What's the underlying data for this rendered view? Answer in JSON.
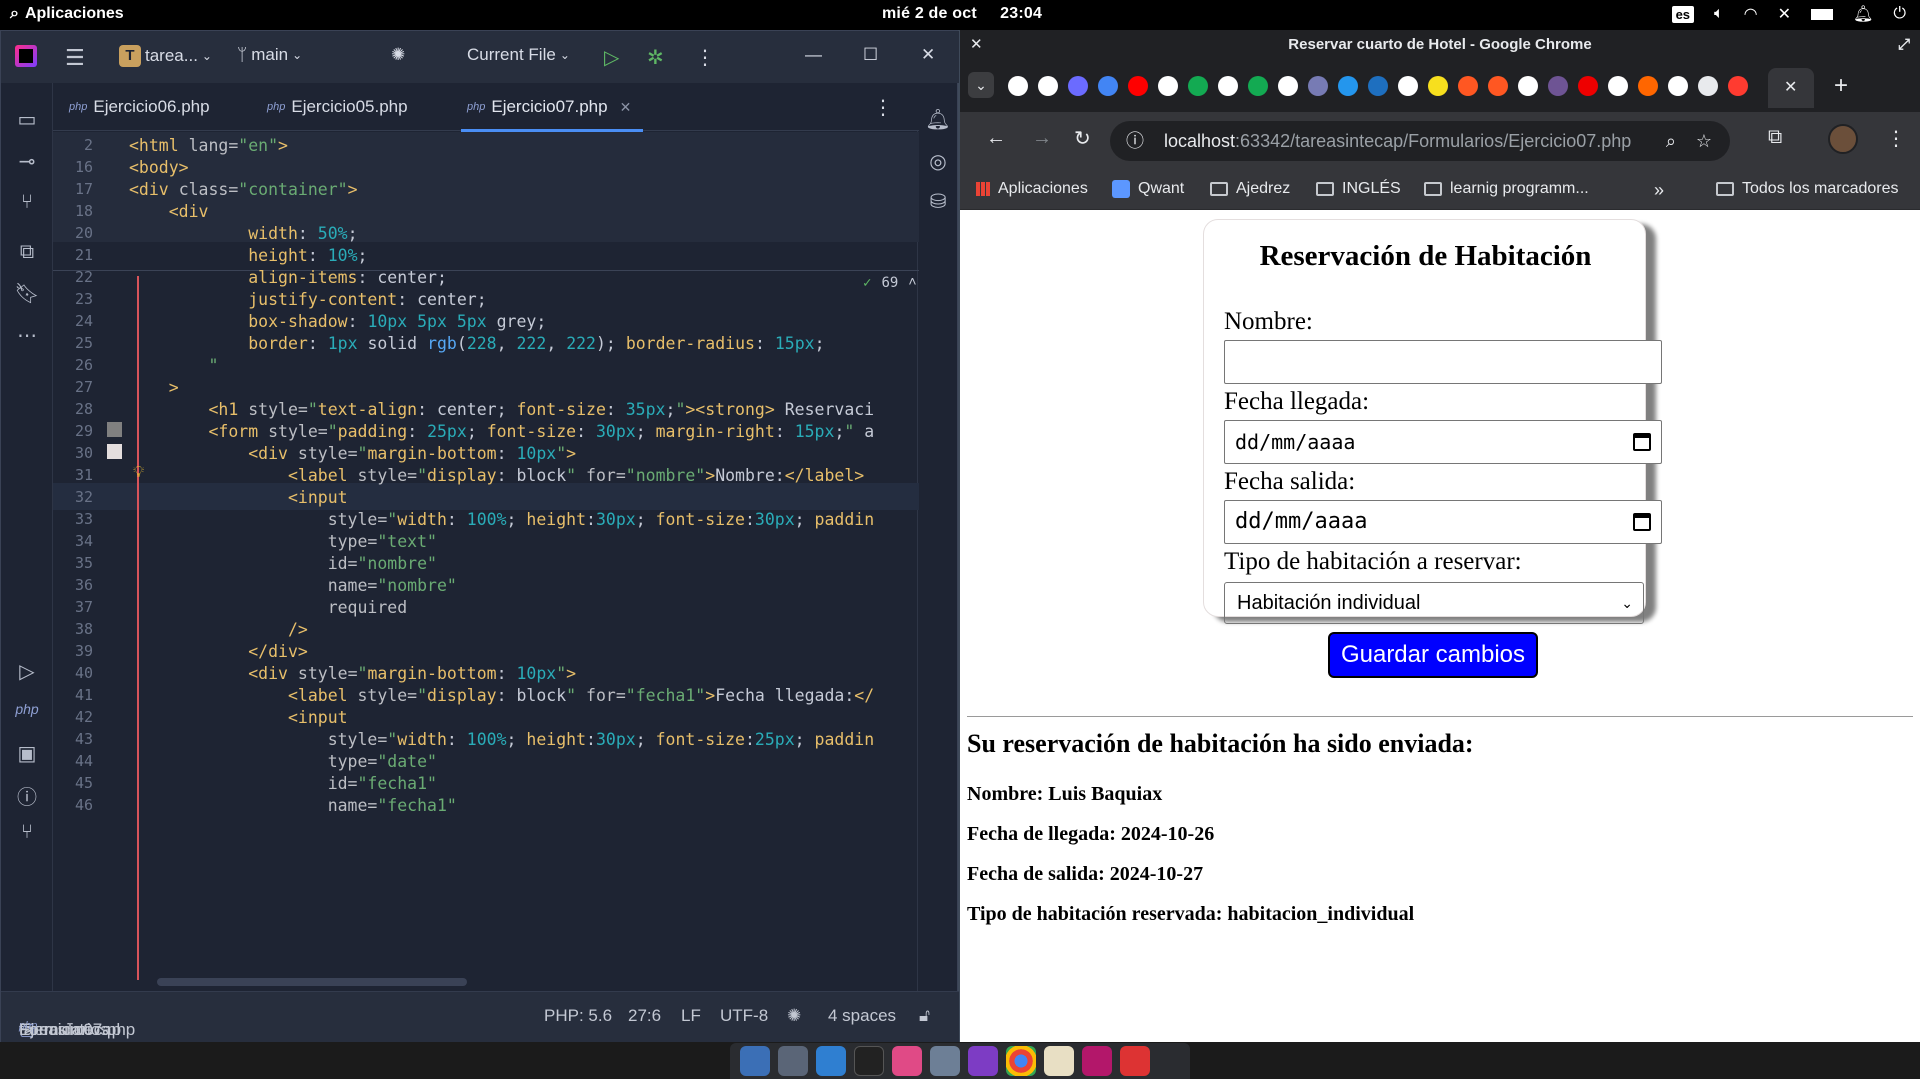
{
  "topbar": {
    "apps_label": "Aplicaciones",
    "datetime": "mié 2 de oct",
    "time": "23:04",
    "keyboard": "es"
  },
  "ide": {
    "project": "tarea...",
    "project_initial": "T",
    "branch": "main",
    "run_config": "Current File",
    "tabs": [
      {
        "prefix": "php",
        "label": "Ejercicio06.php"
      },
      {
        "prefix": "php",
        "label": "Ejercicio05.php"
      },
      {
        "prefix": "php",
        "label": "Ejercicio07.php"
      }
    ],
    "inspection_count": "69",
    "lines": [
      {
        "n": "2",
        "html": "<span class='t-tag'>&lt;html</span> <span class='t-attr'>lang=</span><span class='t-str'>\"en\"</span><span class='t-tag'>&gt;</span>"
      },
      {
        "n": "16",
        "html": "<span class='t-tag'>&lt;body&gt;</span>"
      },
      {
        "n": "17",
        "html": "<span class='t-tag'>&lt;div</span> <span class='t-attr'>class=</span><span class='t-str'>\"container\"</span><span class='t-tag'>&gt;</span>"
      },
      {
        "n": "18",
        "html": "    <span class='t-tag'>&lt;div</span>"
      },
      {
        "n": "20",
        "html": "            <span class='t-tag'>width</span>: <span class='t-num'>50%</span>;"
      },
      {
        "n": "21",
        "html": "            <span class='t-tag'>height</span>: <span class='t-num'>10%</span>;"
      },
      {
        "n": "22",
        "html": "            <span class='t-tag'>align-items</span>: center;"
      },
      {
        "n": "23",
        "html": "            <span class='t-tag'>justify-content</span>: center;"
      },
      {
        "n": "24",
        "html": "            <span class='t-tag'>box-shadow</span>: <span class='t-num'>10px 5px 5px</span> grey;"
      },
      {
        "n": "25",
        "html": "            <span class='t-tag'>border</span>: <span class='t-num'>1px</span> solid <span class='t-fn'>rgb</span>(<span class='t-num'>228</span>, <span class='t-num'>222</span>, <span class='t-num'>222</span>); <span class='t-tag'>border-radius</span>: <span class='t-num'>15px</span>;"
      },
      {
        "n": "26",
        "html": "        <span class='t-str'>\"</span>"
      },
      {
        "n": "27",
        "html": "    <span class='t-tag'>&gt;</span>"
      },
      {
        "n": "28",
        "html": "        <span class='t-tag'>&lt;h1</span> <span class='t-attr'>style=</span><span class='t-str'>\"</span><span class='t-tag'>text-align</span>: center; <span class='t-tag'>font-size</span>: <span class='t-num'>35px</span>;<span class='t-str'>\"</span><span class='t-tag'>&gt;&lt;strong&gt;</span> Reservaci"
      },
      {
        "n": "29",
        "html": "        <span class='t-tag'>&lt;form</span> <span class='t-attr'>style=</span><span class='t-str'>\"</span><span class='t-tag'>padding</span>: <span class='t-num'>25px</span>; <span class='t-tag'>font-size</span>: <span class='t-num'>30px</span>; <span class='t-tag'>margin-right</span>: <span class='t-num'>15px</span>;<span class='t-str'>\"</span> a"
      },
      {
        "n": "30",
        "html": "            <span class='t-tag'>&lt;div</span> <span class='t-attr'>style=</span><span class='t-str'>\"</span><span class='t-tag'>margin-bottom</span>: <span class='t-num'>10px</span><span class='t-str'>\"</span><span class='t-tag'>&gt;</span>"
      },
      {
        "n": "31",
        "html": "                <span class='t-tag'>&lt;label</span> <span class='t-attr'>style=</span><span class='t-str'>\"</span><span class='t-tag'>display</span>: block<span class='t-str'>\"</span> <span class='t-attr'>for=</span><span class='t-str'>\"nombre\"</span><span class='t-tag'>&gt;</span>Nombre:<span class='t-tag'>&lt;/label&gt;</span>"
      },
      {
        "n": "32",
        "html": "                <span class='t-tag'>&lt;input</span>"
      },
      {
        "n": "33",
        "html": "                    <span class='t-attr'>style=</span><span class='t-str'>\"</span><span class='t-tag'>width</span>: <span class='t-num'>100%</span>; <span class='t-tag'>height</span>:<span class='t-num'>30px</span>; <span class='t-tag'>font-size</span>:<span class='t-num'>30px</span>; <span class='t-tag'>paddin</span>"
      },
      {
        "n": "34",
        "html": "                    <span class='t-attr'>type=</span><span class='t-str'>\"text\"</span>"
      },
      {
        "n": "35",
        "html": "                    <span class='t-attr'>id=</span><span class='t-str'>\"nombre\"</span>"
      },
      {
        "n": "36",
        "html": "                    <span class='t-attr'>name=</span><span class='t-str'>\"nombre\"</span>"
      },
      {
        "n": "37",
        "html": "                    <span class='t-attr'>required</span>"
      },
      {
        "n": "38",
        "html": "                <span class='t-tag'>/&gt;</span>"
      },
      {
        "n": "39",
        "html": "            <span class='t-tag'>&lt;/div&gt;</span>"
      },
      {
        "n": "40",
        "html": "            <span class='t-tag'>&lt;div</span> <span class='t-attr'>style=</span><span class='t-str'>\"</span><span class='t-tag'>margin-bottom</span>: <span class='t-num'>10px</span><span class='t-str'>\"</span><span class='t-tag'>&gt;</span>"
      },
      {
        "n": "41",
        "html": "                <span class='t-tag'>&lt;label</span> <span class='t-attr'>style=</span><span class='t-str'>\"</span><span class='t-tag'>display</span>: block<span class='t-str'>\"</span> <span class='t-attr'>for=</span><span class='t-str'>\"fecha1\"</span><span class='t-tag'>&gt;</span>Fecha llegada:<span class='t-tag'>&lt;/</span>"
      },
      {
        "n": "42",
        "html": "                <span class='t-tag'>&lt;input</span>"
      },
      {
        "n": "43",
        "html": "                    <span class='t-attr'>style=</span><span class='t-str'>\"</span><span class='t-tag'>width</span>: <span class='t-num'>100%</span>; <span class='t-tag'>height</span>:<span class='t-num'>30px</span>; <span class='t-tag'>font-size</span>:<span class='t-num'>25px</span>; <span class='t-tag'>paddin</span>"
      },
      {
        "n": "44",
        "html": "                    <span class='t-attr'>type=</span><span class='t-str'>\"date\"</span>"
      },
      {
        "n": "45",
        "html": "                    <span class='t-attr'>id=</span><span class='t-str'>\"fecha1\"</span>"
      },
      {
        "n": "46",
        "html": "                    <span class='t-attr'>name=</span><span class='t-str'>\"fecha1\"</span>"
      }
    ],
    "status": {
      "crumb_project": "tareasintecap",
      "crumb_folder": "Formularios",
      "crumb_file": "Ejercicio07.php",
      "php_version": "PHP: 5.6",
      "cursor": "27:6",
      "line_sep": "LF",
      "encoding": "UTF-8",
      "indent": "4 spaces"
    }
  },
  "chrome": {
    "window_title": "Reservar cuarto de Hotel - Google Chrome",
    "url_host": "localhost",
    "url_rest": ":63342/tareasintecap/Formularios/Ejercicio07.php",
    "bookmarks": [
      "Aplicaciones",
      "Qwant",
      "Ajedrez",
      "INGLÉS",
      "learnig programm...",
      "Todos los marcadores"
    ],
    "form": {
      "title": "Reservación de Habitación",
      "nombre_label": "Nombre:",
      "nombre_value": "",
      "llegada_label": "Fecha llegada:",
      "llegada_value": "dd/mm/aaaa",
      "salida_label": "Fecha salida:",
      "salida_value": "dd/mm/aaaa",
      "tipo_label": "Tipo de habitación a reservar:",
      "tipo_selected": "Habitación individual",
      "submit_label": "Guardar cambios"
    },
    "result": {
      "heading": "Su reservación de habitación ha sido enviada:",
      "nombre": "Nombre: Luis Baquiax",
      "llegada": "Fecha de llegada: 2024-10-26",
      "salida": "Fecha de salida: 2024-10-27",
      "tipo": "Tipo de habitación reservada: habitacion_individual"
    }
  }
}
